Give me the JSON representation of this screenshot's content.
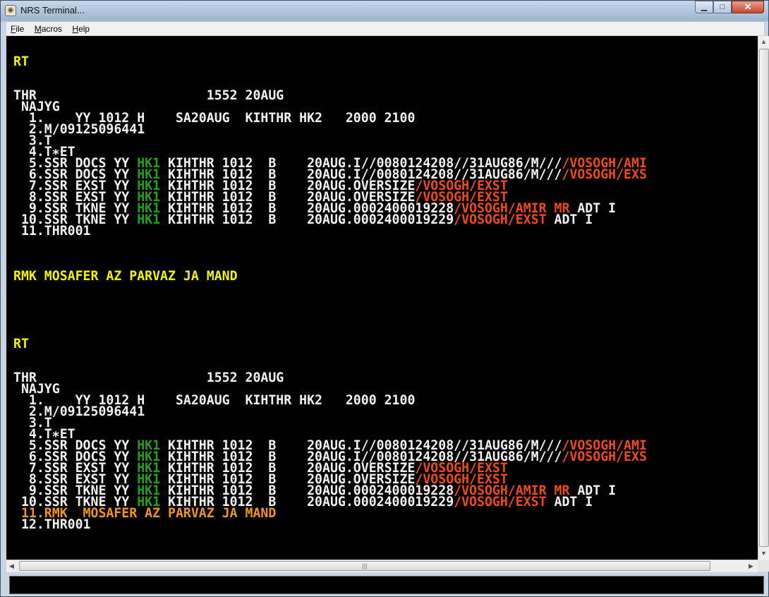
{
  "window": {
    "title": "NRS Terminal...",
    "controls": {
      "minimize": "▁",
      "maximize": "□",
      "close": "✕"
    }
  },
  "menu": [
    {
      "accel": "F",
      "rest": "ile"
    },
    {
      "accel": "M",
      "rest": "acros"
    },
    {
      "accel": "H",
      "rest": "elp"
    }
  ],
  "colors": {
    "white": "#f2f2f2",
    "yellow": "#f3f300",
    "green": "#1fa11f",
    "red": "#ef4a1a",
    "orange": "#f0951e"
  },
  "terminal": {
    "lines": [
      {
        "row": 2,
        "segs": [
          {
            "t": "RT",
            "c": "yellow"
          }
        ]
      },
      {
        "row": 5,
        "segs": [
          {
            "t": "THR                      ",
            "c": "white"
          },
          {
            "t": "1552 20AUG",
            "c": "white"
          }
        ]
      },
      {
        "row": 6,
        "segs": [
          {
            "t": " NAJYG",
            "c": "white"
          }
        ]
      },
      {
        "row": 7,
        "segs": [
          {
            "t": "  1.    YY 1012 H    SA20AUG  KIHTHR HK2   2000 2100",
            "c": "white"
          }
        ]
      },
      {
        "row": 8,
        "segs": [
          {
            "t": "  2.M/09125096441",
            "c": "white"
          }
        ]
      },
      {
        "row": 9,
        "segs": [
          {
            "t": "  3.T",
            "c": "white"
          }
        ]
      },
      {
        "row": 10,
        "segs": [
          {
            "t": "  4.T∗ET",
            "c": "white"
          }
        ]
      },
      {
        "row": 11,
        "segs": [
          {
            "t": "  5.SSR DOCS YY ",
            "c": "white"
          },
          {
            "t": "HK1",
            "c": "green"
          },
          {
            "t": " KIHTHR 1012  B    20AUG.I//0080124208//31AUG86/M///",
            "c": "white"
          },
          {
            "t": "/VOSOGH/AMI",
            "c": "red"
          }
        ]
      },
      {
        "row": 12,
        "segs": [
          {
            "t": "  6.SSR DOCS YY ",
            "c": "white"
          },
          {
            "t": "HK1",
            "c": "green"
          },
          {
            "t": " KIHTHR 1012  B    20AUG.I//0080124208//31AUG86/M///",
            "c": "white"
          },
          {
            "t": "/VOSOGH/EXS",
            "c": "red"
          }
        ]
      },
      {
        "row": 13,
        "segs": [
          {
            "t": "  7.SSR EXST YY ",
            "c": "white"
          },
          {
            "t": "HK1",
            "c": "green"
          },
          {
            "t": " KIHTHR 1012  B    20AUG.OVERSIZE",
            "c": "white"
          },
          {
            "t": "/VOSOGH/EXST",
            "c": "red"
          }
        ]
      },
      {
        "row": 14,
        "segs": [
          {
            "t": "  8.SSR EXST YY ",
            "c": "white"
          },
          {
            "t": "HK1",
            "c": "green"
          },
          {
            "t": " KIHTHR 1012  B    20AUG.OVERSIZE",
            "c": "white"
          },
          {
            "t": "/VOSOGH/EXST",
            "c": "red"
          }
        ]
      },
      {
        "row": 15,
        "segs": [
          {
            "t": "  9.SSR TKNE YY ",
            "c": "white"
          },
          {
            "t": "HK1",
            "c": "green"
          },
          {
            "t": " KIHTHR 1012  B    20AUG.0002400019228",
            "c": "white"
          },
          {
            "t": "/VOSOGH/AMIR MR",
            "c": "red"
          },
          {
            "t": " ADT I",
            "c": "white"
          }
        ]
      },
      {
        "row": 16,
        "segs": [
          {
            "t": " 10.SSR TKNE YY ",
            "c": "white"
          },
          {
            "t": "HK1",
            "c": "green"
          },
          {
            "t": " KIHTHR 1012  B    20AUG.0002400019229",
            "c": "white"
          },
          {
            "t": "/VOSOGH/EXST",
            "c": "red"
          },
          {
            "t": " ADT I",
            "c": "white"
          }
        ]
      },
      {
        "row": 17,
        "segs": [
          {
            "t": " 11.THR001",
            "c": "white"
          }
        ]
      },
      {
        "row": 21,
        "segs": [
          {
            "t": "RMK MOSAFER AZ PARVAZ JA MAND",
            "c": "yellow"
          }
        ]
      },
      {
        "row": 27,
        "segs": [
          {
            "t": "RT",
            "c": "yellow"
          }
        ]
      },
      {
        "row": 30,
        "segs": [
          {
            "t": "THR                      ",
            "c": "white"
          },
          {
            "t": "1552 20AUG",
            "c": "white"
          }
        ]
      },
      {
        "row": 31,
        "segs": [
          {
            "t": " NAJYG",
            "c": "white"
          }
        ]
      },
      {
        "row": 32,
        "segs": [
          {
            "t": "  1.    YY 1012 H    SA20AUG  KIHTHR HK2   2000 2100",
            "c": "white"
          }
        ]
      },
      {
        "row": 33,
        "segs": [
          {
            "t": "  2.M/09125096441",
            "c": "white"
          }
        ]
      },
      {
        "row": 34,
        "segs": [
          {
            "t": "  3.T",
            "c": "white"
          }
        ]
      },
      {
        "row": 35,
        "segs": [
          {
            "t": "  4.T∗ET",
            "c": "white"
          }
        ]
      },
      {
        "row": 36,
        "segs": [
          {
            "t": "  5.SSR DOCS YY ",
            "c": "white"
          },
          {
            "t": "HK1",
            "c": "green"
          },
          {
            "t": " KIHTHR 1012  B    20AUG.I//0080124208//31AUG86/M///",
            "c": "white"
          },
          {
            "t": "/VOSOGH/AMI",
            "c": "red"
          }
        ]
      },
      {
        "row": 37,
        "segs": [
          {
            "t": "  6.SSR DOCS YY ",
            "c": "white"
          },
          {
            "t": "HK1",
            "c": "green"
          },
          {
            "t": " KIHTHR 1012  B    20AUG.I//0080124208//31AUG86/M///",
            "c": "white"
          },
          {
            "t": "/VOSOGH/EXS",
            "c": "red"
          }
        ]
      },
      {
        "row": 38,
        "segs": [
          {
            "t": "  7.SSR EXST YY ",
            "c": "white"
          },
          {
            "t": "HK1",
            "c": "green"
          },
          {
            "t": " KIHTHR 1012  B    20AUG.OVERSIZE",
            "c": "white"
          },
          {
            "t": "/VOSOGH/EXST",
            "c": "red"
          }
        ]
      },
      {
        "row": 39,
        "segs": [
          {
            "t": "  8.SSR EXST YY ",
            "c": "white"
          },
          {
            "t": "HK1",
            "c": "green"
          },
          {
            "t": " KIHTHR 1012  B    20AUG.OVERSIZE",
            "c": "white"
          },
          {
            "t": "/VOSOGH/EXST",
            "c": "red"
          }
        ]
      },
      {
        "row": 40,
        "segs": [
          {
            "t": "  9.SSR TKNE YY ",
            "c": "white"
          },
          {
            "t": "HK1",
            "c": "green"
          },
          {
            "t": " KIHTHR 1012  B    20AUG.0002400019228",
            "c": "white"
          },
          {
            "t": "/VOSOGH/AMIR MR",
            "c": "red"
          },
          {
            "t": " ADT I",
            "c": "white"
          }
        ]
      },
      {
        "row": 41,
        "segs": [
          {
            "t": " 10.SSR TKNE YY ",
            "c": "white"
          },
          {
            "t": "HK1",
            "c": "green"
          },
          {
            "t": " KIHTHR 1012  B    20AUG.0002400019229",
            "c": "white"
          },
          {
            "t": "/VOSOGH/EXST",
            "c": "red"
          },
          {
            "t": " ADT I",
            "c": "white"
          }
        ]
      },
      {
        "row": 42,
        "segs": [
          {
            "t": " 11.RMK  MOSAFER AZ PARVAZ JA MAND",
            "c": "orange"
          }
        ]
      },
      {
        "row": 43,
        "segs": [
          {
            "t": " 12.THR001",
            "c": "white"
          }
        ]
      }
    ]
  },
  "scrollbars": {
    "up": "▲",
    "down": "▼",
    "left": "◀",
    "right": "▶",
    "grip": "|||"
  },
  "command": {
    "value": ""
  }
}
